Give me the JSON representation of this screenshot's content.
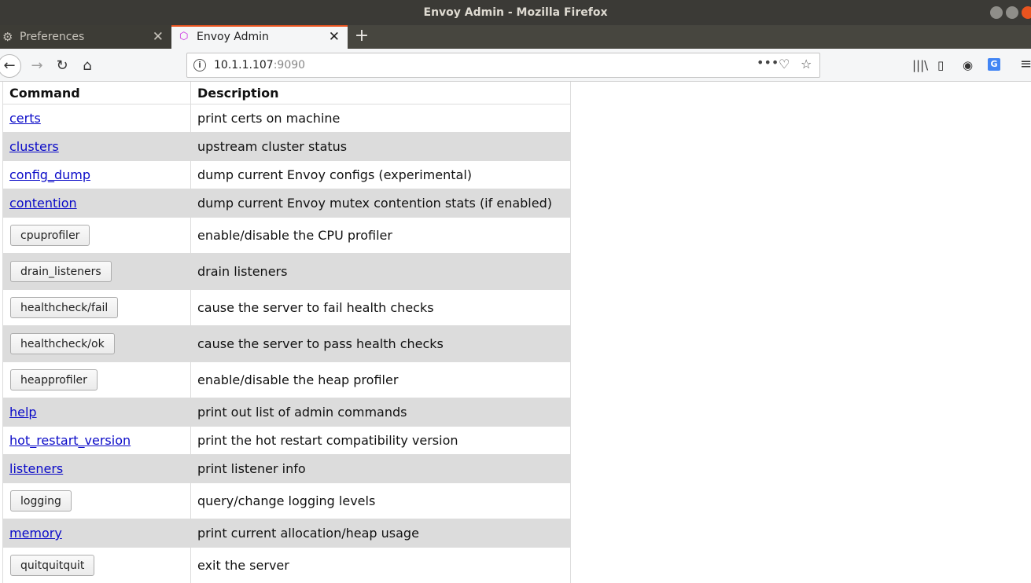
{
  "window": {
    "title": "Envoy Admin - Mozilla Firefox"
  },
  "tabs": [
    {
      "label": "Preferences",
      "icon": "gear-icon",
      "active": false
    },
    {
      "label": "Envoy Admin",
      "icon": "envoy-icon",
      "active": true
    }
  ],
  "nav": {
    "url_host": "10.1.1.107",
    "url_port": ":9090"
  },
  "table": {
    "headers": [
      "Command",
      "Description"
    ],
    "rows": [
      {
        "command": "certs",
        "kind": "link",
        "description": "print certs on machine"
      },
      {
        "command": "clusters",
        "kind": "link",
        "description": "upstream cluster status"
      },
      {
        "command": "config_dump",
        "kind": "link",
        "description": "dump current Envoy configs (experimental)"
      },
      {
        "command": "contention",
        "kind": "link",
        "description": "dump current Envoy mutex contention stats (if enabled)"
      },
      {
        "command": "cpuprofiler",
        "kind": "button",
        "description": "enable/disable the CPU profiler"
      },
      {
        "command": "drain_listeners",
        "kind": "button",
        "description": "drain listeners"
      },
      {
        "command": "healthcheck/fail",
        "kind": "button",
        "description": "cause the server to fail health checks"
      },
      {
        "command": "healthcheck/ok",
        "kind": "button",
        "description": "cause the server to pass health checks"
      },
      {
        "command": "heapprofiler",
        "kind": "button",
        "description": "enable/disable the heap profiler"
      },
      {
        "command": "help",
        "kind": "link",
        "description": "print out list of admin commands"
      },
      {
        "command": "hot_restart_version",
        "kind": "link",
        "description": "print the hot restart compatibility version"
      },
      {
        "command": "listeners",
        "kind": "link",
        "description": "print listener info"
      },
      {
        "command": "logging",
        "kind": "button",
        "description": "query/change logging levels"
      },
      {
        "command": "memory",
        "kind": "link",
        "description": "print current allocation/heap usage"
      },
      {
        "command": "quitquitquit",
        "kind": "button",
        "description": "exit the server"
      }
    ]
  },
  "colors": {
    "accent": "#e95420",
    "link": "#0a0ac8",
    "row_shade": "#dcdcdc"
  }
}
